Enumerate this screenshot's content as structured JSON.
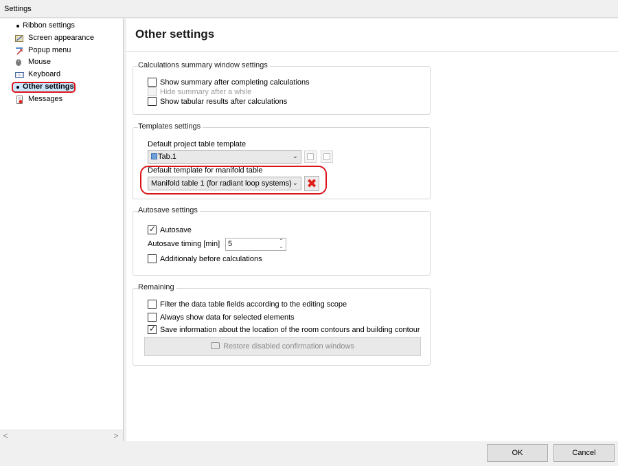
{
  "window": {
    "title": "Settings"
  },
  "sidebar": {
    "items": [
      {
        "label": "Ribbon settings",
        "icon": "bullet"
      },
      {
        "label": "Screen appearance",
        "icon": "screen-appearance-icon"
      },
      {
        "label": "Popup menu",
        "icon": "popup-menu-icon"
      },
      {
        "label": "Mouse",
        "icon": "mouse-icon"
      },
      {
        "label": "Keyboard",
        "icon": "keyboard-icon"
      },
      {
        "label": "Other settings",
        "icon": "bullet",
        "selected": true
      },
      {
        "label": "Messages",
        "icon": "messages-icon"
      }
    ],
    "scroll_left": "<",
    "scroll_right": ">"
  },
  "main": {
    "title": "Other settings",
    "calc_group": {
      "legend": "Calculations summary window settings",
      "show_summary": {
        "label": "Show summary after completing calculations",
        "checked": false
      },
      "hide_summary": {
        "label": "Hide summary after a while",
        "checked": false,
        "disabled": true
      },
      "show_tabular": {
        "label": "Show tabular results after calculations",
        "checked": false
      }
    },
    "templates_group": {
      "legend": "Templates settings",
      "project_label": "Default project table template",
      "project_value": "Tab.1",
      "manifold_label": "Default template for manifold table",
      "manifold_value": "Manifold table 1 (for radiant loop systems)",
      "delete_glyph": "✖"
    },
    "autosave_group": {
      "legend": "Autosave settings",
      "autosave": {
        "label": "Autosave",
        "checked": true
      },
      "timing_label": "Autosave timing [min]",
      "timing_value": "5",
      "additional": {
        "label": "Additionaly before calculations",
        "checked": false
      }
    },
    "remaining_group": {
      "legend": "Remaining",
      "filter": {
        "label": "Filter the data table fields according to the editing scope",
        "checked": false
      },
      "always_show": {
        "label": "Always show data for selected elements",
        "checked": false
      },
      "save_info": {
        "label": "Save information about the location of the room contours and building contour",
        "checked": true
      },
      "restore_label": "Restore disabled confirmation windows"
    }
  },
  "footer": {
    "ok_label": "OK",
    "cancel_label": "Cancel"
  },
  "colors": {
    "highlight": "#d9151b",
    "selection": "#cce8ff"
  }
}
